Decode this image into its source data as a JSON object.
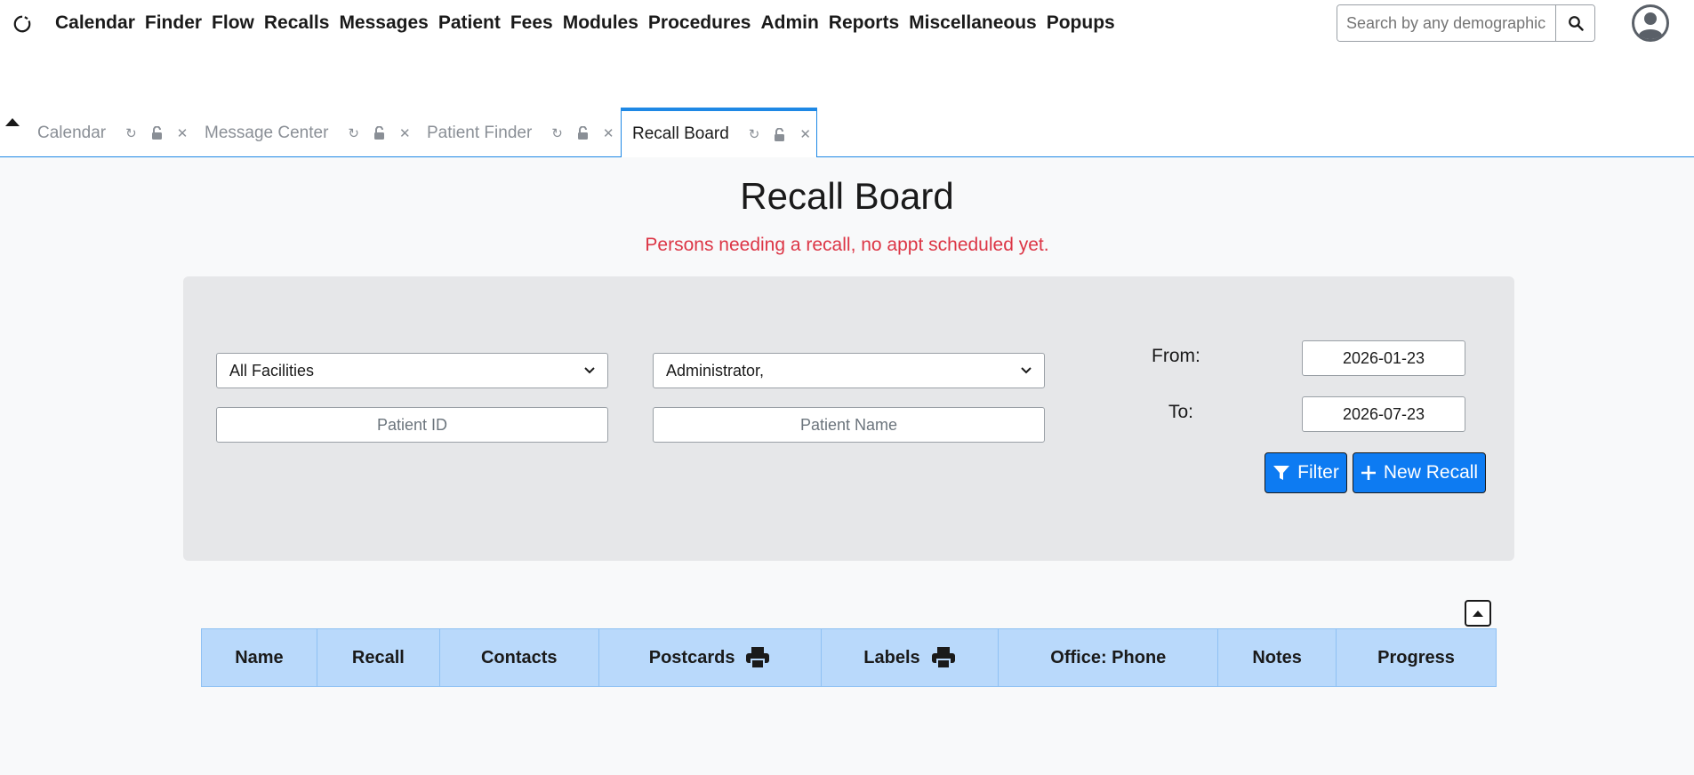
{
  "nav": {
    "menu": [
      "Calendar",
      "Finder",
      "Flow",
      "Recalls",
      "Messages",
      "Patient",
      "Fees",
      "Modules",
      "Procedures",
      "Admin",
      "Reports",
      "Miscellaneous",
      "Popups"
    ],
    "search_placeholder": "Search by any demographic"
  },
  "tabs": [
    {
      "label": "Calendar",
      "active": false
    },
    {
      "label": "Message Center",
      "active": false
    },
    {
      "label": "Patient Finder",
      "active": false
    },
    {
      "label": "Recall Board",
      "active": true
    }
  ],
  "page": {
    "title": "Recall Board",
    "subtitle": "Persons needing a recall, no appt scheduled yet."
  },
  "filters": {
    "facility_selected": "All Facilities",
    "provider_selected": "Administrator,",
    "patient_id_placeholder": "Patient ID",
    "patient_name_placeholder": "Patient Name",
    "from_label": "From:",
    "to_label": "To:",
    "from_value": "2026-01-23",
    "to_value": "2026-07-23",
    "filter_label": "Filter",
    "new_recall_label": "New Recall"
  },
  "table": {
    "headers": [
      "Name",
      "Recall",
      "Contacts",
      "Postcards",
      "Labels",
      "Office: Phone",
      "Notes",
      "Progress"
    ]
  },
  "colors": {
    "accent": "#1e88e5",
    "button": "#0d7bf2",
    "subtitle": "#dc3545",
    "table_header": "#b9d9fb"
  }
}
